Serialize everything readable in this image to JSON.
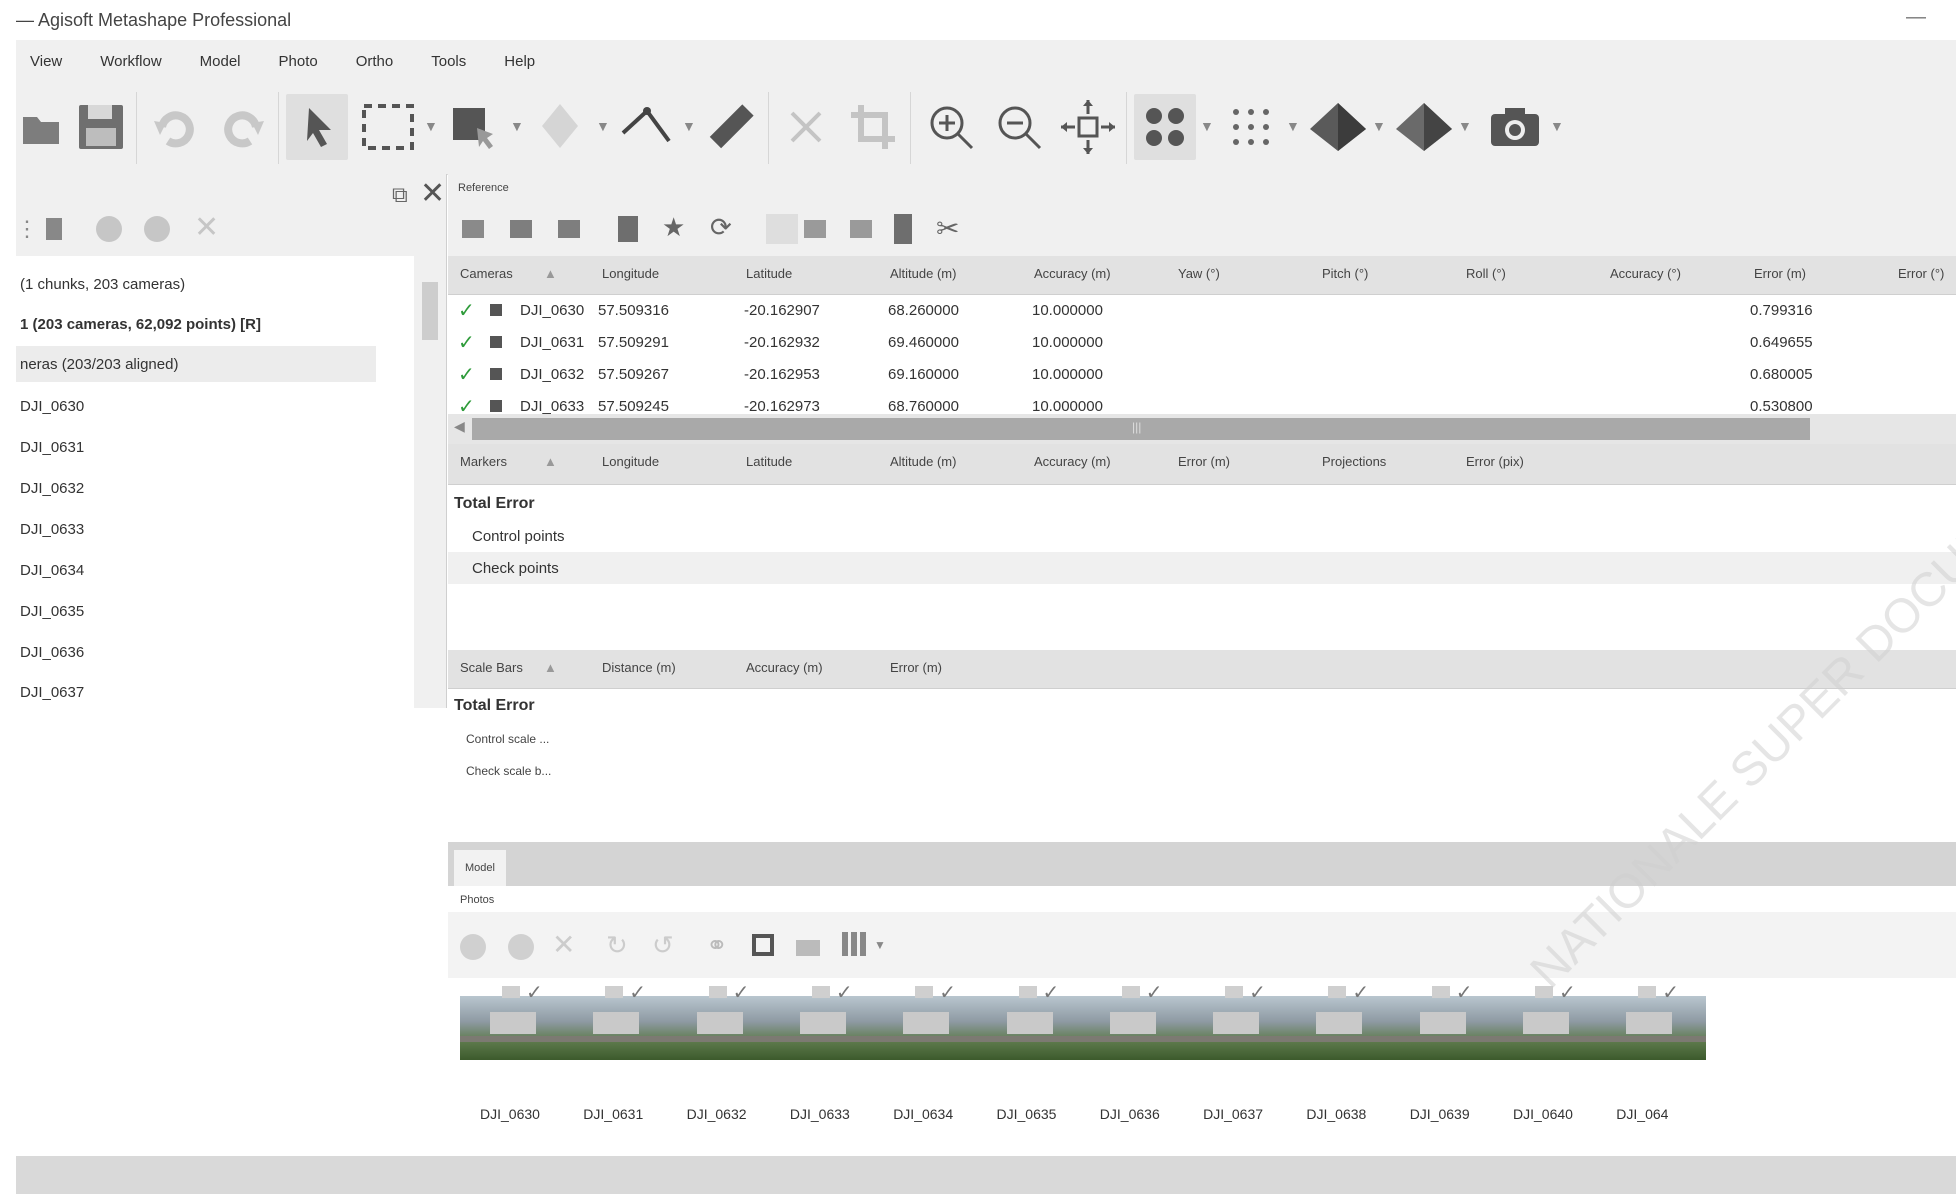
{
  "app": {
    "title": "— Agisoft Metashape Professional",
    "minimize_glyph": "—"
  },
  "menu": [
    "View",
    "Workflow",
    "Model",
    "Photo",
    "Ortho",
    "Tools",
    "Help"
  ],
  "toolbar": {
    "icons": [
      "open-icon",
      "save-icon",
      "undo-icon",
      "redo-icon",
      "navigation-icon",
      "rectangle-selection-icon",
      "transform-region-icon",
      "shape-icon",
      "ruler-icon",
      "delete-icon",
      "crop-icon",
      "zoom-in-icon",
      "zoom-out-icon",
      "reset-view-icon",
      "show-cameras-icon",
      "show-points-icon",
      "model-solid-icon",
      "model-textured-icon",
      "capture-view-icon"
    ]
  },
  "workspace": {
    "tree": [
      {
        "label": "(1 chunks, 203 cameras)",
        "bold": false,
        "selected": false
      },
      {
        "label": "1 (203 cameras, 62,092 points) [R]",
        "bold": true,
        "selected": false
      },
      {
        "label": "neras (203/203 aligned)",
        "bold": false,
        "selected": true
      },
      {
        "label": "DJI_0630"
      },
      {
        "label": "DJI_0631"
      },
      {
        "label": "DJI_0632"
      },
      {
        "label": "DJI_0633"
      },
      {
        "label": "DJI_0634"
      },
      {
        "label": "DJI_0635"
      },
      {
        "label": "DJI_0636"
      },
      {
        "label": "DJI_0637"
      }
    ]
  },
  "reference": {
    "label": "Reference",
    "camera_headers": [
      "Cameras",
      "Longitude",
      "Latitude",
      "Altitude (m)",
      "Accuracy (m)",
      "Yaw (°)",
      "Pitch (°)",
      "Roll (°)",
      "Accuracy (°)",
      "Error (m)",
      "Error (°)"
    ],
    "cameras": [
      {
        "name": "DJI_0630",
        "lon": "57.509316",
        "lat": "-20.162907",
        "alt": "68.260000",
        "acc": "10.000000",
        "err": "0.799316"
      },
      {
        "name": "DJI_0631",
        "lon": "57.509291",
        "lat": "-20.162932",
        "alt": "69.460000",
        "acc": "10.000000",
        "err": "0.649655"
      },
      {
        "name": "DJI_0632",
        "lon": "57.509267",
        "lat": "-20.162953",
        "alt": "69.160000",
        "acc": "10.000000",
        "err": "0.680005"
      },
      {
        "name": "DJI_0633",
        "lon": "57.509245",
        "lat": "-20.162973",
        "alt": "68.760000",
        "acc": "10.000000",
        "err": "0.530800"
      }
    ],
    "hscroll_grip": "|||",
    "marker_headers": [
      "Markers",
      "Longitude",
      "Latitude",
      "Altitude (m)",
      "Accuracy (m)",
      "Error (m)",
      "Projections",
      "Error (pix)"
    ],
    "markers": {
      "total": "Total Error",
      "control": "Control points",
      "check": "Check points"
    },
    "scalebar_headers": [
      "Scale Bars",
      "Distance (m)",
      "Accuracy (m)",
      "Error (m)"
    ],
    "scalebars": {
      "total": "Total Error",
      "control": "Control scale ...",
      "check": "Check scale b..."
    }
  },
  "model": {
    "tab": "Model"
  },
  "photos": {
    "label": "Photos",
    "items": [
      "DJI_0630",
      "DJI_0631",
      "DJI_0632",
      "DJI_0633",
      "DJI_0634",
      "DJI_0635",
      "DJI_0636",
      "DJI_0637",
      "DJI_0638",
      "DJI_0639",
      "DJI_0640",
      "DJI_064"
    ]
  },
  "watermark": "NATIONALE SUPER DOCUMENT"
}
